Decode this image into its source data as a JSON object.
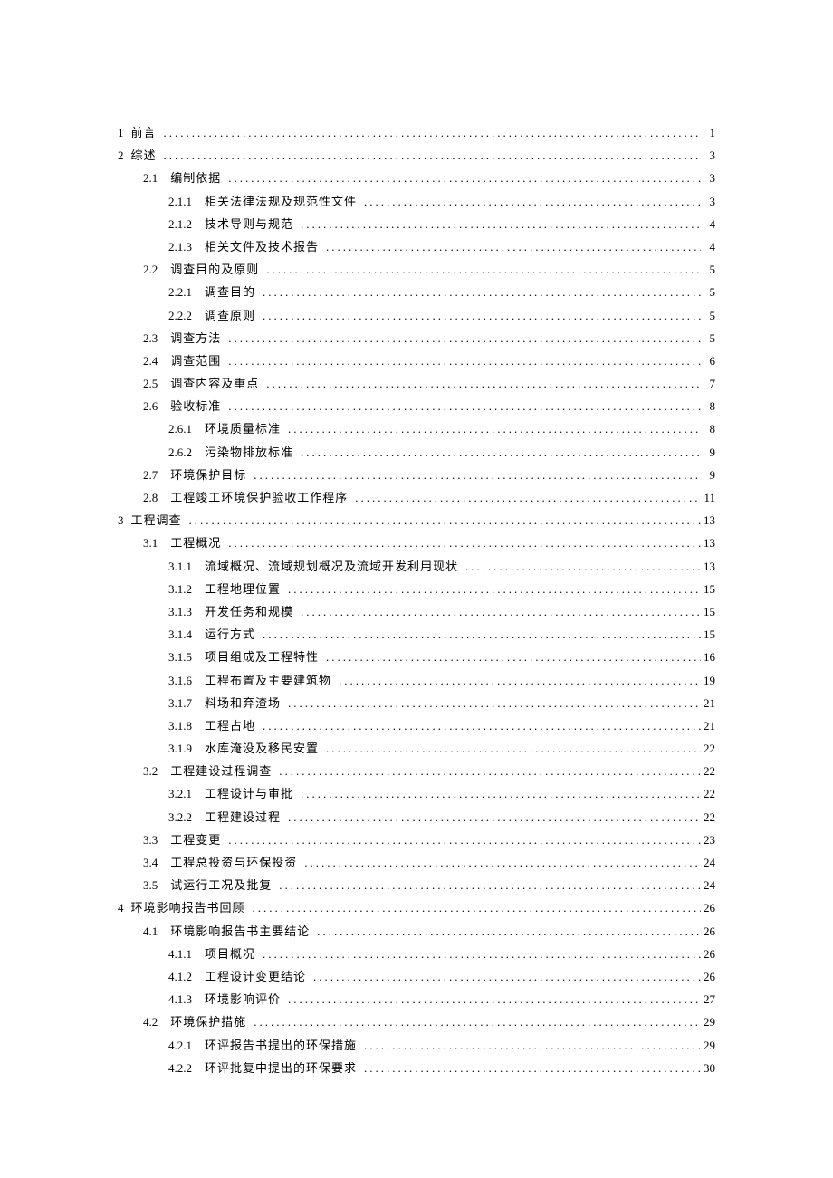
{
  "toc": [
    {
      "indent": 0,
      "num": "1",
      "title": "前言",
      "page": "1",
      "spaced": true
    },
    {
      "indent": 0,
      "num": "2",
      "title": "综述",
      "page": "3",
      "spaced": true
    },
    {
      "indent": 1,
      "num": "2.1",
      "title": "编制依据",
      "page": "3",
      "spaced": false
    },
    {
      "indent": 2,
      "num": "2.1.1",
      "title": "相关法律法规及规范性文件",
      "page": "3",
      "spaced": false
    },
    {
      "indent": 2,
      "num": "2.1.2",
      "title": "技术导则与规范",
      "page": "4",
      "spaced": false
    },
    {
      "indent": 2,
      "num": "2.1.3",
      "title": "相关文件及技术报告",
      "page": "4",
      "spaced": false
    },
    {
      "indent": 1,
      "num": "2.2",
      "title": "调查目的及原则",
      "page": "5",
      "spaced": false
    },
    {
      "indent": 2,
      "num": "2.2.1",
      "title": "调查目的",
      "page": "5",
      "spaced": false
    },
    {
      "indent": 2,
      "num": "2.2.2",
      "title": "调查原则",
      "page": "5",
      "spaced": false
    },
    {
      "indent": 1,
      "num": "2.3",
      "title": "调查方法",
      "page": "5",
      "spaced": false
    },
    {
      "indent": 1,
      "num": "2.4",
      "title": "调查范围",
      "page": "6",
      "spaced": false
    },
    {
      "indent": 1,
      "num": "2.5",
      "title": "调查内容及重点",
      "page": "7",
      "spaced": false
    },
    {
      "indent": 1,
      "num": "2.6",
      "title": "验收标准",
      "page": "8",
      "spaced": false
    },
    {
      "indent": 2,
      "num": "2.6.1",
      "title": "环境质量标准",
      "page": "8",
      "spaced": false
    },
    {
      "indent": 2,
      "num": "2.6.2",
      "title": "污染物排放标准",
      "page": "9",
      "spaced": false
    },
    {
      "indent": 1,
      "num": "2.7",
      "title": "环境保护目标",
      "page": "9",
      "spaced": false
    },
    {
      "indent": 1,
      "num": "2.8",
      "title": "工程竣工环境保护验收工作程序",
      "page": "11",
      "spaced": false
    },
    {
      "indent": 0,
      "num": "3",
      "title": "工程调查",
      "page": "13",
      "spaced": true
    },
    {
      "indent": 1,
      "num": "3.1",
      "title": "工程概况",
      "page": "13",
      "spaced": false
    },
    {
      "indent": 2,
      "num": "3.1.1",
      "title": "流域概况、流域规划概况及流域开发利用现状",
      "page": "13",
      "spaced": false
    },
    {
      "indent": 2,
      "num": "3.1.2",
      "title": "工程地理位置",
      "page": "15",
      "spaced": false
    },
    {
      "indent": 2,
      "num": "3.1.3",
      "title": "开发任务和规模",
      "page": "15",
      "spaced": false
    },
    {
      "indent": 2,
      "num": "3.1.4",
      "title": "运行方式",
      "page": "15",
      "spaced": false
    },
    {
      "indent": 2,
      "num": "3.1.5",
      "title": "项目组成及工程特性",
      "page": "16",
      "spaced": false
    },
    {
      "indent": 2,
      "num": "3.1.6",
      "title": "工程布置及主要建筑物",
      "page": "19",
      "spaced": false
    },
    {
      "indent": 2,
      "num": "3.1.7",
      "title": "料场和弃渣场",
      "page": "21",
      "spaced": false
    },
    {
      "indent": 2,
      "num": "3.1.8",
      "title": "工程占地",
      "page": "21",
      "spaced": false
    },
    {
      "indent": 2,
      "num": "3.1.9",
      "title": "水库淹没及移民安置",
      "page": "22",
      "spaced": false
    },
    {
      "indent": 1,
      "num": "3.2",
      "title": "工程建设过程调查",
      "page": "22",
      "spaced": false
    },
    {
      "indent": 2,
      "num": "3.2.1",
      "title": "工程设计与审批",
      "page": "22",
      "spaced": false
    },
    {
      "indent": 2,
      "num": "3.2.2",
      "title": "工程建设过程",
      "page": "22",
      "spaced": false
    },
    {
      "indent": 1,
      "num": "3.3",
      "title": "工程变更",
      "page": "23",
      "spaced": false
    },
    {
      "indent": 1,
      "num": "3.4",
      "title": "工程总投资与环保投资",
      "page": "24",
      "spaced": false
    },
    {
      "indent": 1,
      "num": "3.5",
      "title": "试运行工况及批复",
      "page": "24",
      "spaced": false
    },
    {
      "indent": 0,
      "num": "4",
      "title": "环境影响报告书回顾",
      "page": "26",
      "spaced": true
    },
    {
      "indent": 1,
      "num": "4.1",
      "title": "环境影响报告书主要结论",
      "page": "26",
      "spaced": false
    },
    {
      "indent": 2,
      "num": "4.1.1",
      "title": "项目概况",
      "page": "26",
      "spaced": false
    },
    {
      "indent": 2,
      "num": "4.1.2",
      "title": "工程设计变更结论",
      "page": "26",
      "spaced": false
    },
    {
      "indent": 2,
      "num": "4.1.3",
      "title": "环境影响评价",
      "page": "27",
      "spaced": false
    },
    {
      "indent": 1,
      "num": "4.2",
      "title": "环境保护措施",
      "page": "29",
      "spaced": false
    },
    {
      "indent": 2,
      "num": "4.2.1",
      "title": "环评报告书提出的环保措施",
      "page": "29",
      "spaced": false
    },
    {
      "indent": 2,
      "num": "4.2.2",
      "title": "环评批复中提出的环保要求",
      "page": "30",
      "spaced": false
    }
  ]
}
